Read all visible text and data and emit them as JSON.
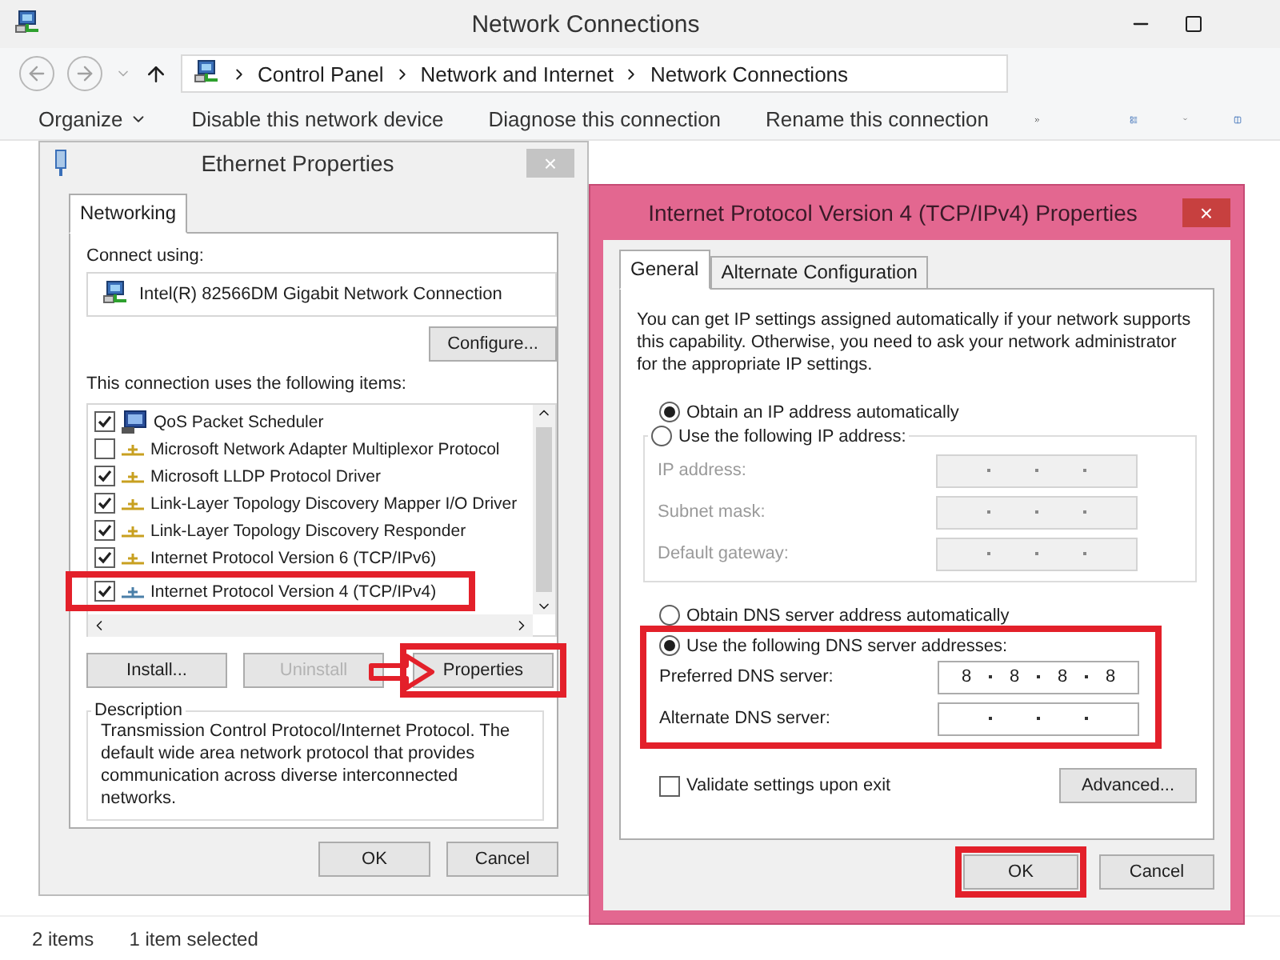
{
  "explorer": {
    "title": "Network Connections",
    "address": [
      "Control Panel",
      "Network and Internet",
      "Network Connections"
    ],
    "toolbar": [
      {
        "label": "Organize",
        "dropdown": true
      },
      {
        "label": "Disable this network device",
        "dropdown": false
      },
      {
        "label": "Diagnose this connection",
        "dropdown": false
      },
      {
        "label": "Rename this connection",
        "dropdown": false
      }
    ],
    "status_bar": [
      "2 items",
      "1 item selected"
    ]
  },
  "ethernet_dialog": {
    "title": "Ethernet Properties",
    "active": false,
    "close": "×",
    "tabs": [
      {
        "label": "Networking",
        "selected": true
      }
    ],
    "connect_using_label": "Connect using:",
    "adapter": "Intel(R) 82566DM Gigabit Network Connection",
    "configure_button": "Configure...",
    "items_label": "This connection uses the following items:",
    "items": [
      {
        "kind": "service",
        "label": "QoS Packet Scheduler",
        "checked": true,
        "highlighted": false
      },
      {
        "kind": "protocol",
        "label": "Microsoft Network Adapter Multiplexor Protocol",
        "checked": false,
        "highlighted": false
      },
      {
        "kind": "protocol",
        "label": "Microsoft LLDP Protocol Driver",
        "checked": true,
        "highlighted": false
      },
      {
        "kind": "protocol",
        "label": "Link-Layer Topology Discovery Mapper I/O Driver",
        "checked": true,
        "highlighted": false
      },
      {
        "kind": "protocol",
        "label": "Link-Layer Topology Discovery Responder",
        "checked": true,
        "highlighted": false
      },
      {
        "kind": "protocol",
        "label": "Internet Protocol Version 6 (TCP/IPv6)",
        "checked": true,
        "highlighted": false
      },
      {
        "kind": "protocol",
        "label": "Internet Protocol Version 4 (TCP/IPv4)",
        "checked": true,
        "highlighted": true
      }
    ],
    "buttons": [
      {
        "label": "Install...",
        "disabled": false,
        "highlighted": false
      },
      {
        "label": "Uninstall",
        "disabled": true,
        "highlighted": false
      },
      {
        "label": "Properties",
        "disabled": false,
        "highlighted": true
      }
    ],
    "pointer_arrow": true,
    "description": {
      "title": "Description",
      "text": "Transmission Control Protocol/Internet Protocol. The default wide area network protocol that provides communication across diverse interconnected networks."
    },
    "footer_buttons": [
      "OK",
      "Cancel"
    ]
  },
  "ipv4_dialog": {
    "title": "Internet Protocol Version 4 (TCP/IPv4) Properties",
    "active": true,
    "close": "×",
    "tabs": [
      {
        "label": "General",
        "selected": true
      },
      {
        "label": "Alternate Configuration",
        "selected": false
      }
    ],
    "intro": "You can get IP settings assigned automatically if your network supports this capability. Otherwise, you need to ask your network administrator for the appropriate IP settings.",
    "ip_options": [
      {
        "label": "Obtain an IP address automatically",
        "selected": true
      },
      {
        "label": "Use the following IP address:",
        "selected": false
      }
    ],
    "ip_fields": [
      {
        "label": "IP address:",
        "disabled": true
      },
      {
        "label": "Subnet mask:",
        "disabled": true
      },
      {
        "label": "Default gateway:",
        "disabled": true
      }
    ],
    "dns_options": [
      {
        "label": "Obtain DNS server address automatically",
        "selected": false
      },
      {
        "label": "Use the following DNS server addresses:",
        "selected": true
      }
    ],
    "dns_highlighted": true,
    "dns_fields": [
      {
        "label": "Preferred DNS server:",
        "disabled": false,
        "value": [
          "8",
          "8",
          "8",
          "8"
        ]
      },
      {
        "label": "Alternate DNS server:",
        "disabled": false
      }
    ],
    "validate": {
      "label": "Validate settings upon exit",
      "checked": false
    },
    "advanced_button": "Advanced...",
    "footer_buttons": [
      {
        "label": "OK",
        "highlighted": true
      },
      {
        "label": "Cancel",
        "highlighted": false
      }
    ]
  }
}
